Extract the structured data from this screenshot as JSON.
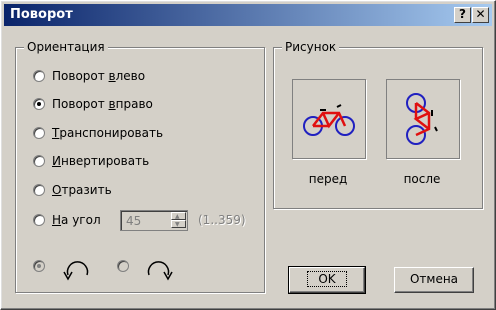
{
  "window": {
    "title": "Поворот",
    "help_label": "?",
    "close_label": "✕"
  },
  "orientation": {
    "legend": "Ориентация",
    "options": [
      {
        "pre": "Поворот ",
        "key": "в",
        "post": "лево",
        "checked": false
      },
      {
        "pre": "Поворот ",
        "key": "в",
        "post": "право",
        "checked": true
      },
      {
        "pre": "",
        "key": "Т",
        "post": "ранспонировать",
        "checked": false
      },
      {
        "pre": "",
        "key": "И",
        "post": "нвертировать",
        "checked": false
      },
      {
        "pre": "",
        "key": "О",
        "post": "тразить",
        "checked": false
      }
    ],
    "angle": {
      "key": "Н",
      "post": "а угол",
      "value": "45",
      "range": "(1..359)"
    },
    "direction_icons": [
      "rotate-ccw-icon",
      "rotate-cw-icon"
    ]
  },
  "picture": {
    "legend": "Рисунок",
    "before_label": "перед",
    "after_label": "после",
    "icon": "bicycle-icon"
  },
  "buttons": {
    "ok": "OK",
    "cancel": "Отмена"
  }
}
